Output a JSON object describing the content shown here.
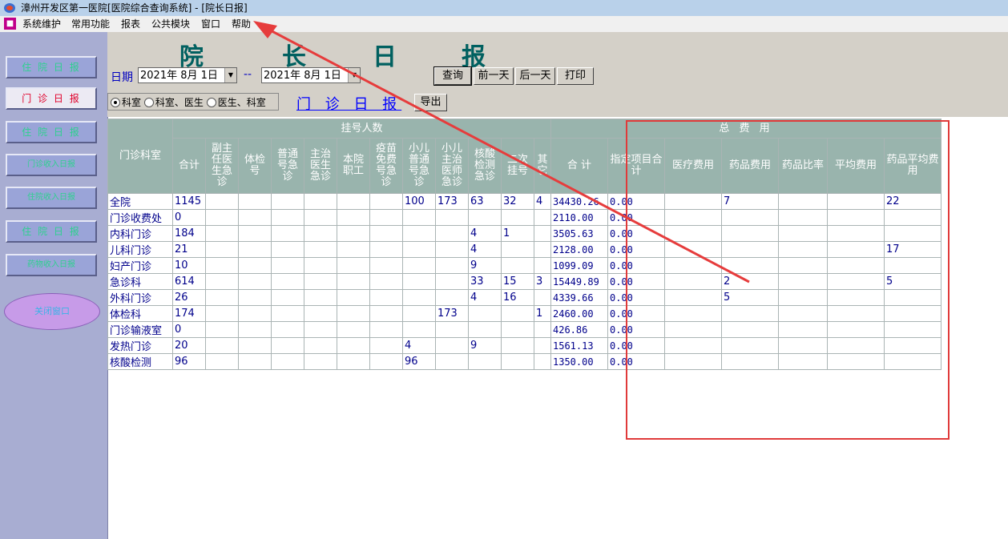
{
  "window": {
    "title": "漳州开发区第一医院[医院综合查询系统] - [院长日报]"
  },
  "menu": [
    "系统维护",
    "常用功能",
    "报表",
    "公共模块",
    "窗口",
    "帮助"
  ],
  "sidebar": {
    "buttons": [
      "住 院 日 报",
      "门 诊 日 报",
      "住 院 日 报",
      "门诊收入日报",
      "住院收入日报",
      "住 院 日 报",
      "药物收入日报"
    ],
    "active_index": 1,
    "close_label": "关闭窗口"
  },
  "header": {
    "title_chars": [
      "院",
      "长",
      "日",
      "报"
    ],
    "date_label": "日期",
    "date_from": "2021年  8月  1日",
    "date_sep": "--",
    "date_to": "2021年  8月  1日",
    "buttons": {
      "query": "查询",
      "prev": "前一天",
      "next": "后一天",
      "print": "打印",
      "export": "导出"
    },
    "radios": [
      "科室",
      "科室、医生",
      "医生、科室"
    ],
    "radio_selected": 0,
    "report_name": "门 诊 日 报"
  },
  "table": {
    "dept_header": "门诊科室",
    "group_reg": "挂号人数",
    "group_fee": "总 费 用",
    "reg_columns": [
      "合计",
      "副主任医生急诊",
      "体检号",
      "普通号急诊",
      "主治医生急诊",
      "本院职工",
      "疫苗免费号急诊",
      "小儿普通号急诊",
      "小儿主治医师急诊",
      "核酸检测急诊",
      "二次挂号",
      "其它"
    ],
    "fee_columns": [
      "合  计",
      "指定项目合计",
      "医疗费用",
      "药品费用",
      "药品比率",
      "平均费用",
      "药品平均费用"
    ],
    "rows": [
      {
        "dept": "全院",
        "reg": [
          "1145",
          "",
          "",
          "",
          "",
          "",
          "",
          "100",
          "173",
          "63",
          "32",
          "4"
        ],
        "fee": [
          "34430.26",
          "0.00",
          "",
          "7",
          "",
          "",
          "22"
        ]
      },
      {
        "dept": "门诊收费处",
        "reg": [
          "0",
          "",
          "",
          "",
          "",
          "",
          "",
          "",
          "",
          "",
          "",
          ""
        ],
        "fee": [
          "2110.00",
          "0.00",
          "",
          "",
          "",
          "",
          ""
        ]
      },
      {
        "dept": "内科门诊",
        "reg": [
          "184",
          "",
          "",
          "",
          "",
          "",
          "",
          "",
          "",
          "4",
          "1",
          ""
        ],
        "fee": [
          "3505.63",
          "0.00",
          "",
          "",
          "",
          "",
          ""
        ]
      },
      {
        "dept": "儿科门诊",
        "reg": [
          "21",
          "",
          "",
          "",
          "",
          "",
          "",
          "",
          "",
          "4",
          "",
          ""
        ],
        "fee": [
          "2128.00",
          "0.00",
          "",
          "",
          "",
          "",
          "17"
        ]
      },
      {
        "dept": "妇产门诊",
        "reg": [
          "10",
          "",
          "",
          "",
          "",
          "",
          "",
          "",
          "",
          "9",
          "",
          ""
        ],
        "fee": [
          "1099.09",
          "0.00",
          "",
          "",
          "",
          "",
          ""
        ]
      },
      {
        "dept": "急诊科",
        "reg": [
          "614",
          "",
          "",
          "",
          "",
          "",
          "",
          "",
          "",
          "33",
          "15",
          "3"
        ],
        "fee": [
          "15449.89",
          "0.00",
          "",
          "2",
          "",
          "",
          "5"
        ]
      },
      {
        "dept": "外科门诊",
        "reg": [
          "26",
          "",
          "",
          "",
          "",
          "",
          "",
          "",
          "",
          "4",
          "16",
          ""
        ],
        "fee": [
          "4339.66",
          "0.00",
          "",
          "5",
          "",
          "",
          ""
        ]
      },
      {
        "dept": "体检科",
        "reg": [
          "174",
          "",
          "",
          "",
          "",
          "",
          "",
          "",
          "173",
          "",
          "",
          "1"
        ],
        "fee": [
          "2460.00",
          "0.00",
          "",
          "",
          "",
          "",
          ""
        ]
      },
      {
        "dept": "门诊输液室",
        "reg": [
          "0",
          "",
          "",
          "",
          "",
          "",
          "",
          "",
          "",
          "",
          "",
          ""
        ],
        "fee": [
          "426.86",
          "0.00",
          "",
          "",
          "",
          "",
          ""
        ]
      },
      {
        "dept": "发热门诊",
        "reg": [
          "20",
          "",
          "",
          "",
          "",
          "",
          "",
          "4",
          "",
          "9",
          "",
          ""
        ],
        "fee": [
          "1561.13",
          "0.00",
          "",
          "",
          "",
          "",
          ""
        ]
      },
      {
        "dept": "核酸检测",
        "reg": [
          "96",
          "",
          "",
          "",
          "",
          "",
          "",
          "96",
          "",
          "",
          "",
          ""
        ],
        "fee": [
          "1350.00",
          "0.00",
          "",
          "",
          "",
          "",
          ""
        ]
      }
    ]
  },
  "colors": {
    "annotation": "#e03a3a",
    "header_bg": "#99b4ad",
    "cell_text": "#00008b"
  }
}
